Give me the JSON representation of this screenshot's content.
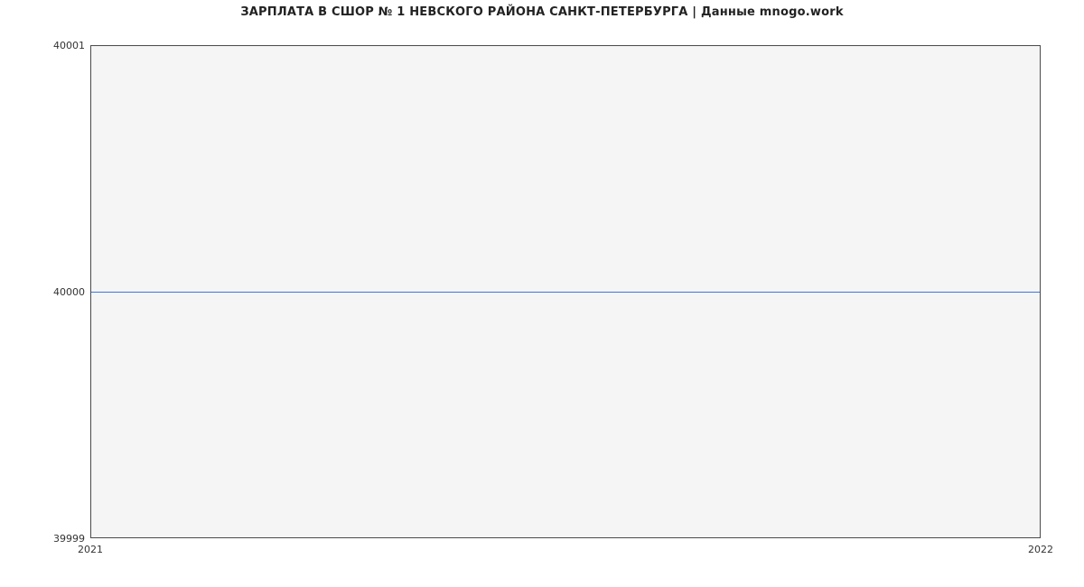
{
  "chart_data": {
    "type": "line",
    "title": "ЗАРПЛАТА В СШОР № 1 НЕВСКОГО РАЙОНА САНКТ-ПЕТЕРБУРГА | Данные mnogo.work",
    "x": [
      2021,
      2022
    ],
    "values": [
      40000,
      40000
    ],
    "xlabel": "",
    "ylabel": "",
    "xlim": [
      2021,
      2022
    ],
    "ylim": [
      39999,
      40001
    ],
    "x_ticks": [
      2021,
      2022
    ],
    "y_ticks": [
      39999,
      40000,
      40001
    ],
    "grid": true,
    "line_color": "#3b78e7",
    "plot_bg": "#f5f5f5"
  },
  "labels": {
    "y_top": "40001",
    "y_mid": "40000",
    "y_bot": "39999",
    "x_left": "2021",
    "x_right": "2022"
  }
}
